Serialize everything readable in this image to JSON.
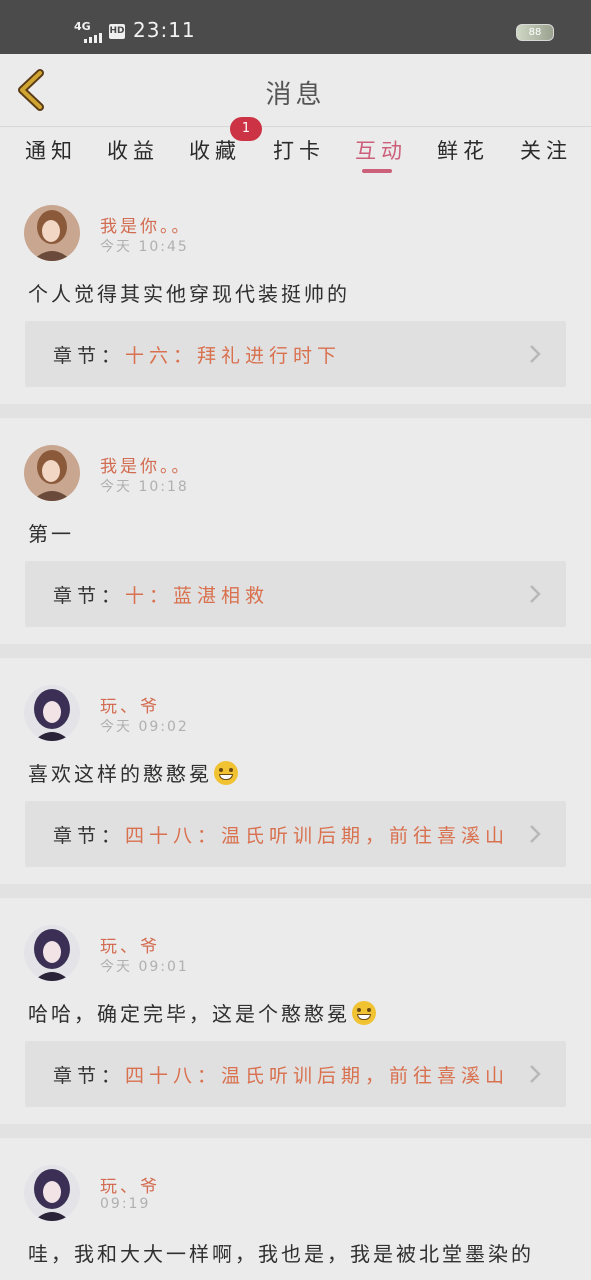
{
  "status_bar": {
    "network": "4G",
    "hd": "HD",
    "time": "23:11",
    "battery": "88"
  },
  "header": {
    "title": "消息",
    "back_icon": "chevron-left-icon"
  },
  "tabs": [
    {
      "label": "通知"
    },
    {
      "label": "收益"
    },
    {
      "label": "收藏",
      "badge": "1"
    },
    {
      "label": "打卡"
    },
    {
      "label": "互动",
      "active": true
    },
    {
      "label": "鲜花"
    },
    {
      "label": "关注"
    }
  ],
  "chapter_label": "章节：",
  "messages": [
    {
      "user": "我是你。。",
      "time": "今天 10:45",
      "text": "个人觉得其实他穿现代装挺帅的",
      "chapter": "十六：拜礼进行时下"
    },
    {
      "user": "我是你。。",
      "time": "今天 10:18",
      "text": "第一",
      "chapter": "十：蓝湛相救"
    },
    {
      "user": "玩、爷",
      "time": "今天 09:02",
      "text": "喜欢这样的憨憨冕",
      "emoji": "grin",
      "chapter": "四十八：温氏听训后期，前往喜溪山"
    },
    {
      "user": "玩、爷",
      "time": "今天 09:01",
      "text": "哈哈，确定完毕，这是个憨憨冕",
      "emoji": "laugh",
      "chapter": "四十八：温氏听训后期，前往喜溪山"
    },
    {
      "user": "玩、爷",
      "time": "09:19",
      "text": "哇，我和大大一样啊，我也是，我是被北堂墨染的"
    }
  ],
  "colors": {
    "accent": "#cc5f79",
    "username": "#d26c50",
    "chapter_title": "#d9704e",
    "badge": "#cc3345"
  }
}
